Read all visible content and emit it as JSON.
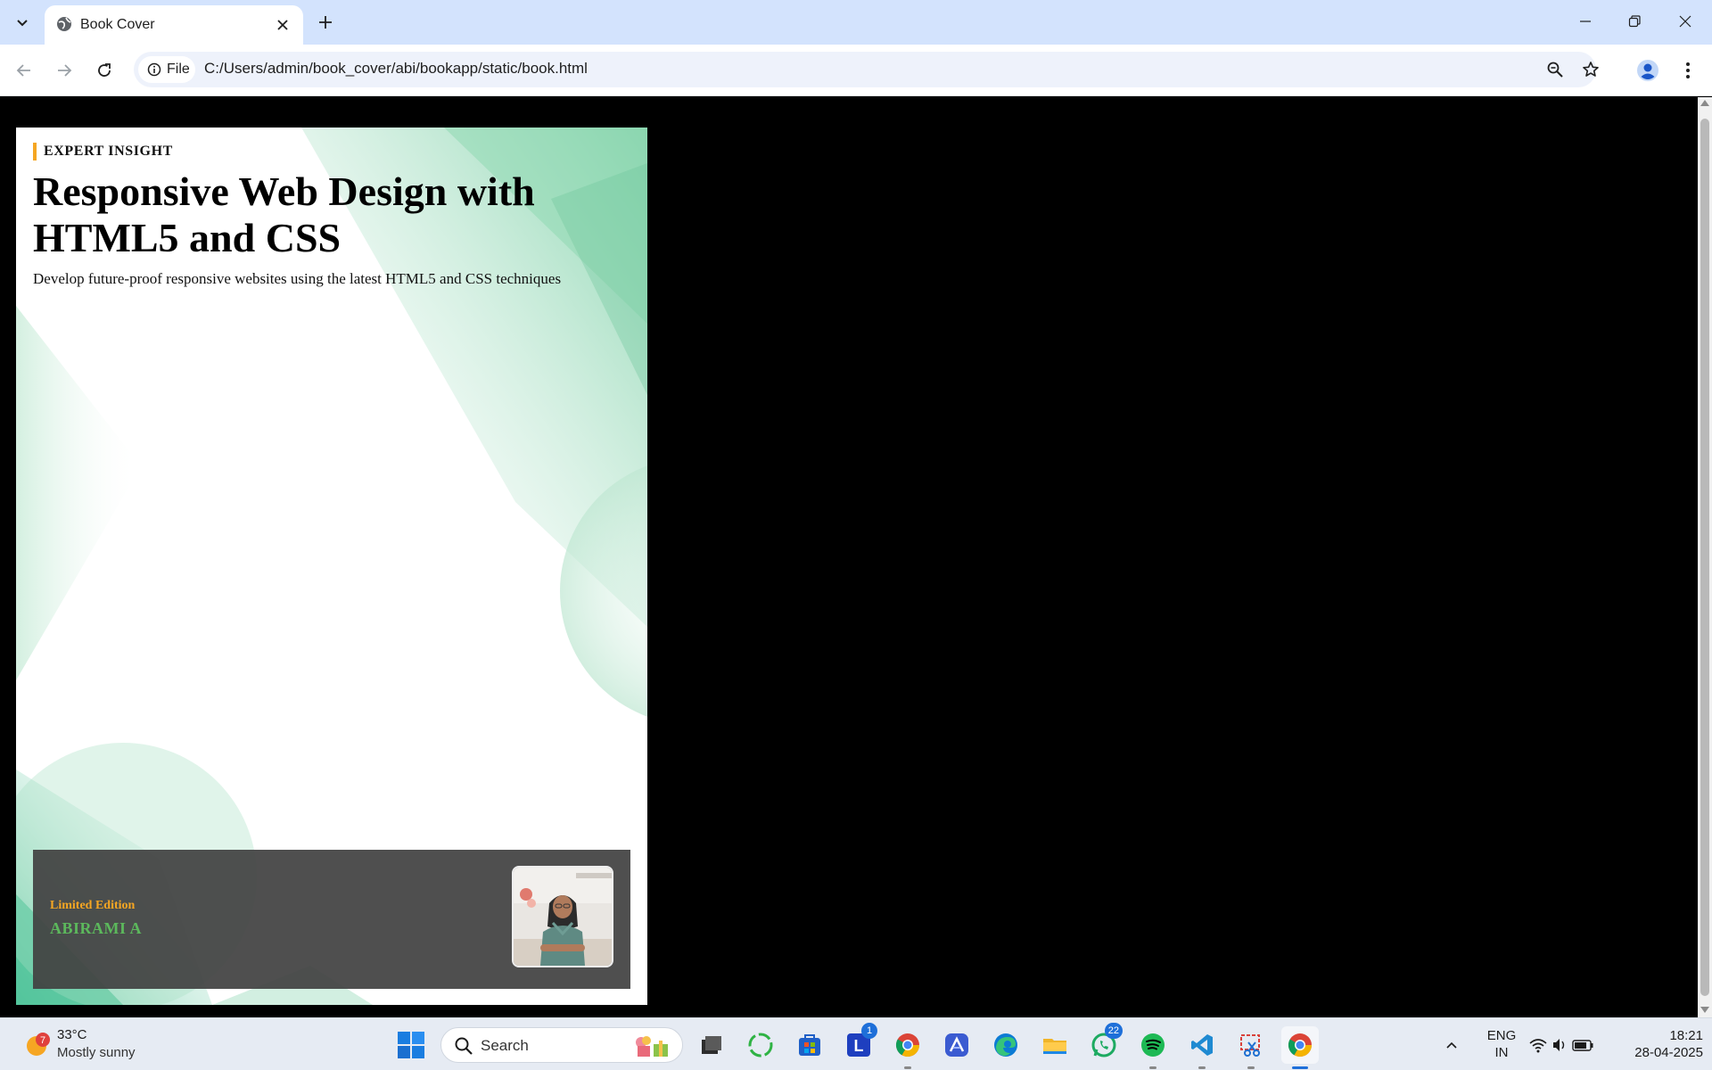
{
  "browser": {
    "tab_title": "Book Cover",
    "site_chip_label": "File",
    "url": "C:/Users/admin/book_cover/abi/bookapp/static/book.html"
  },
  "book": {
    "series_label": "EXPERT INSIGHT",
    "title": "Responsive Web Design with HTML5 and CSS",
    "subtitle": "Develop future-proof responsive websites using the latest HTML5 and CSS techniques",
    "edition_label": "Limited Edition",
    "author": "ABIRAMI A",
    "colors": {
      "accent": "#f5a623",
      "author_green": "#5cb85c",
      "cover_green": "#7fd1a8"
    }
  },
  "taskbar": {
    "weather_badge": "7",
    "temperature": "33°C",
    "condition": "Mostly sunny",
    "search_label": "Search",
    "lang_line1": "ENG",
    "lang_line2": "IN",
    "time": "18:21",
    "date": "28-04-2025",
    "apps": [
      {
        "name": "task-view"
      },
      {
        "name": "copilot"
      },
      {
        "name": "microsoft-store"
      },
      {
        "name": "l-app",
        "badge": "1"
      },
      {
        "name": "chrome-profile"
      },
      {
        "name": "affinity"
      },
      {
        "name": "edge"
      },
      {
        "name": "file-explorer"
      },
      {
        "name": "whatsapp",
        "badge": "22"
      },
      {
        "name": "spotify"
      },
      {
        "name": "vscode"
      },
      {
        "name": "snipping-tool"
      },
      {
        "name": "chrome"
      }
    ]
  }
}
